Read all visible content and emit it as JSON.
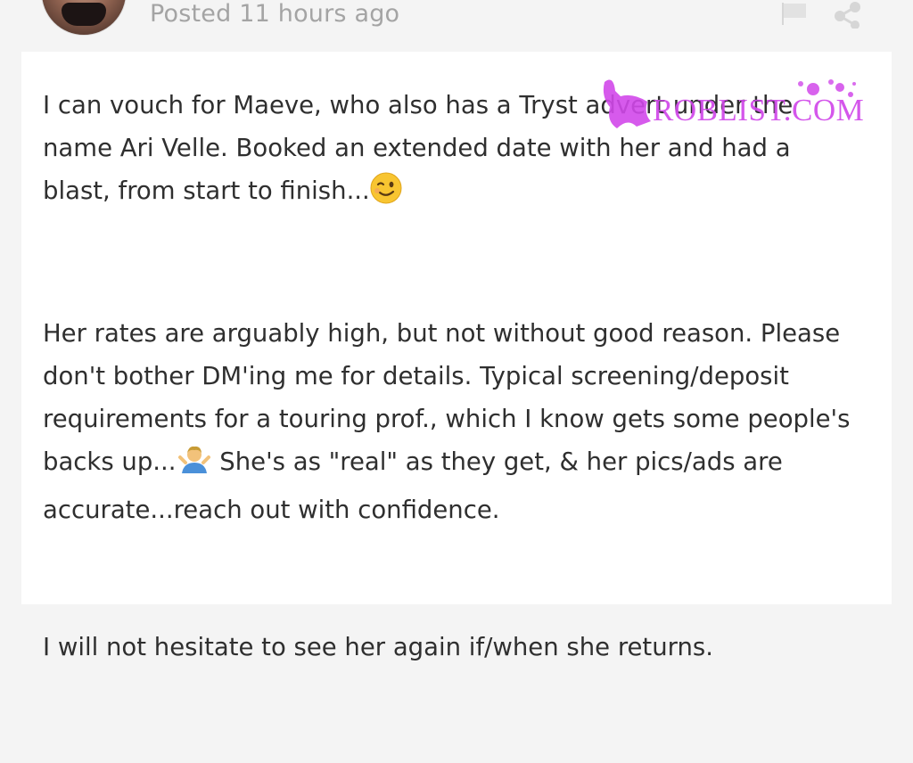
{
  "post": {
    "posted_label": "Posted 11 hours ago",
    "paragraphs": {
      "p1": {
        "text": "I can vouch for Maeve, who also has a Tryst advert under the name Ari Velle. Booked an extended date with her and had a blast, from start to finish...",
        "emoji": "winking-face"
      },
      "p2": {
        "text_before": "Her rates are arguably high, but not without good reason. Please don't bother DM'ing me for details. Typical screening/deposit requirements for a touring prof., which I know gets some people's backs up...",
        "emoji": "person-shrugging",
        "text_after": "She's as \"real\" as they get, & her pics/ads are accurate...reach out with confidence."
      },
      "p3": {
        "text": "I will not hesitate to see her again if/when she returns."
      }
    }
  },
  "watermark": {
    "text": "ROBLIST.COM",
    "color": "#d148ea"
  },
  "colors": {
    "page_background": "#f4f4f4",
    "card_background": "#ffffff",
    "body_text": "#2f2f2f",
    "meta_text": "#a4a4a4",
    "icon": "#d6d6d6"
  },
  "icons": {
    "flag": "flag-icon",
    "share": "share-icon"
  }
}
